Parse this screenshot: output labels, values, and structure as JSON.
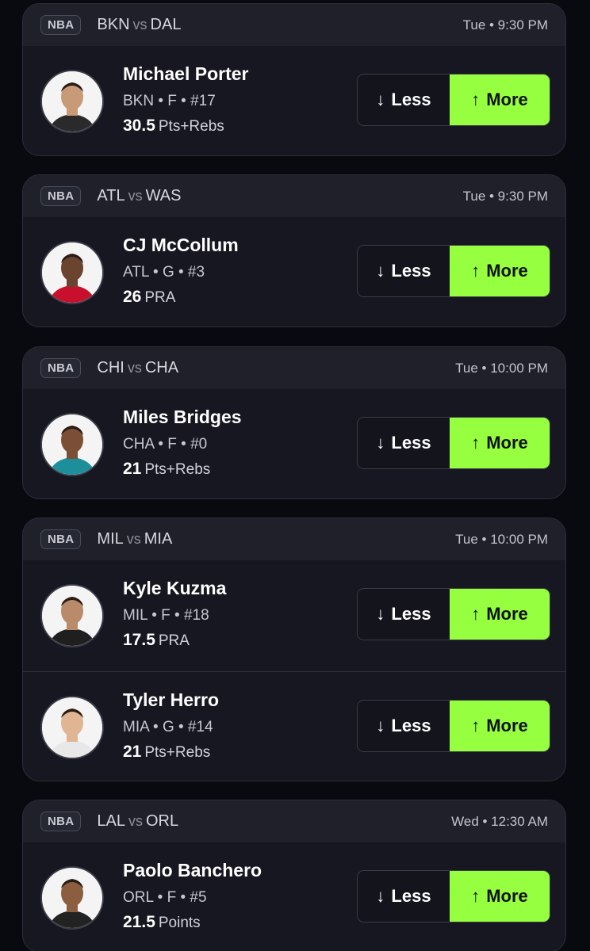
{
  "colors": {
    "background": "#090a10",
    "card": "#161720",
    "card_header": "#1f2029",
    "more_button": "#96ff3f"
  },
  "buttons": {
    "less_label": "Less",
    "more_label": "More",
    "less_icon": "arrow-down-icon",
    "more_icon": "arrow-up-icon"
  },
  "games": [
    {
      "league": "NBA",
      "home": "BKN",
      "vs": "vs",
      "away": "DAL",
      "time": "Tue • 9:30 PM",
      "players": [
        {
          "name": "Michael Porter",
          "meta": "BKN • F • #17",
          "line": "30.5",
          "stat": "Pts+Rebs",
          "jersey_color": "#2a2a2a",
          "skin": "#c99a77"
        }
      ]
    },
    {
      "league": "NBA",
      "home": "ATL",
      "vs": "vs",
      "away": "WAS",
      "time": "Tue • 9:30 PM",
      "players": [
        {
          "name": "CJ McCollum",
          "meta": "ATL • G • #3",
          "line": "26",
          "stat": "PRA",
          "jersey_color": "#c8102e",
          "skin": "#6b4430"
        }
      ]
    },
    {
      "league": "NBA",
      "home": "CHI",
      "vs": "vs",
      "away": "CHA",
      "time": "Tue • 10:00 PM",
      "players": [
        {
          "name": "Miles Bridges",
          "meta": "CHA • F • #0",
          "line": "21",
          "stat": "Pts+Rebs",
          "jersey_color": "#1d8f9a",
          "skin": "#7a4f36"
        }
      ]
    },
    {
      "league": "NBA",
      "home": "MIL",
      "vs": "vs",
      "away": "MIA",
      "time": "Tue • 10:00 PM",
      "players": [
        {
          "name": "Kyle Kuzma",
          "meta": "MIL • F • #18",
          "line": "17.5",
          "stat": "PRA",
          "jersey_color": "#1f1f1f",
          "skin": "#b98b6a"
        },
        {
          "name": "Tyler Herro",
          "meta": "MIA • G • #14",
          "line": "21",
          "stat": "Pts+Rebs",
          "jersey_color": "#e8e8e8",
          "skin": "#e0b594"
        }
      ]
    },
    {
      "league": "NBA",
      "home": "LAL",
      "vs": "vs",
      "away": "ORL",
      "time": "Wed • 12:30 AM",
      "players": [
        {
          "name": "Paolo Banchero",
          "meta": "ORL • F • #5",
          "line": "21.5",
          "stat": "Points",
          "jersey_color": "#222222",
          "skin": "#8c5e40"
        }
      ]
    }
  ]
}
